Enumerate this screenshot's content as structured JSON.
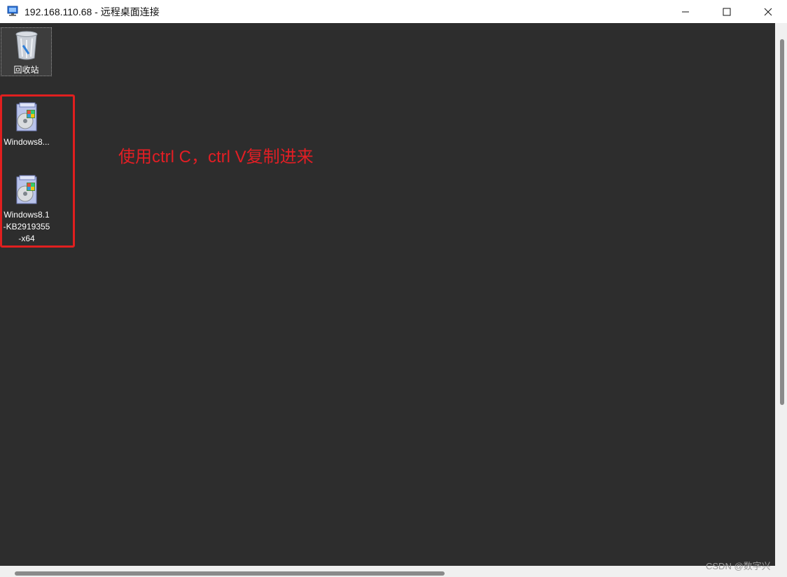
{
  "window": {
    "title": "192.168.110.68 - 远程桌面连接"
  },
  "desktop": {
    "icons": [
      {
        "label": "回收站",
        "icon": "recycle-bin-icon"
      },
      {
        "label": "Windows8...",
        "icon": "installer-package-icon"
      },
      {
        "label": "Windows8.1\n-KB2919355\n-x64",
        "icon": "installer-package-icon"
      }
    ],
    "annotation": "使用ctrl C，ctrl V复制进来",
    "highlight_color": "#e01f1f"
  },
  "watermark": "CSDN @数字兴",
  "colors": {
    "desktop_bg": "#2d2d2d",
    "titlebar_bg": "#ffffff",
    "annotation": "#e31e24"
  }
}
